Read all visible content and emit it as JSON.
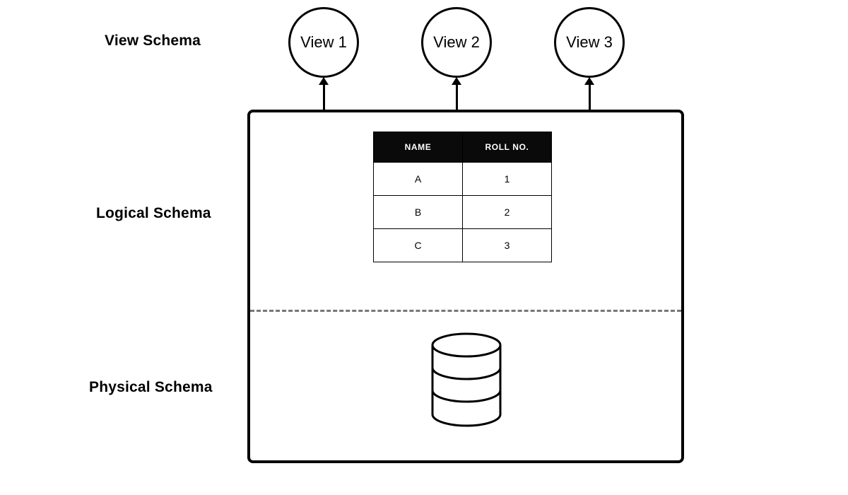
{
  "labels": {
    "view_schema": "View Schema",
    "logical_schema": "Logical Schema",
    "physical_schema": "Physical Schema"
  },
  "views": {
    "v1": "View 1",
    "v2": "View 2",
    "v3": "View 3"
  },
  "table": {
    "headers": {
      "name": "NAME",
      "roll": "ROLL NO."
    },
    "rows": {
      "r0": {
        "name": "A",
        "roll": "1"
      },
      "r1": {
        "name": "B",
        "roll": "2"
      },
      "r2": {
        "name": "C",
        "roll": "3"
      }
    }
  }
}
